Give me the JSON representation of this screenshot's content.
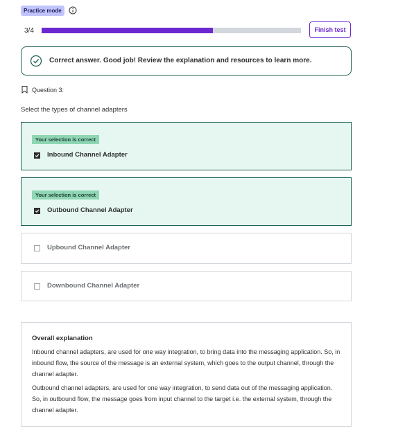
{
  "header": {
    "mode_badge": "Practice mode",
    "progress_text": "3/4",
    "progress_fraction": 0.66,
    "finish_label": "Finish test"
  },
  "result": {
    "message": "Correct answer. Good job! Review the explanation and resources to learn more."
  },
  "question": {
    "label": "Question 3:",
    "text": "Select the types of channel adapters"
  },
  "options": [
    {
      "tag": "Your selection is correct",
      "label": "Inbound Channel Adapter",
      "checked": true
    },
    {
      "tag": "Your selection is correct",
      "label": "Outbound Channel Adapter",
      "checked": true
    },
    {
      "label": "Upbound Channel Adapter",
      "checked": false
    },
    {
      "label": "Downbound Channel Adapter",
      "checked": false
    }
  ],
  "explanation": {
    "title": "Overall explanation",
    "paragraphs": [
      "Inbound channel adapters, are used for one way integration, to bring data into the messaging application. So, in inbound flow, the source of the message is an external system, which goes to the output channel, through the channel adapter.",
      "Outbound channel adapters, are used for one way integration, to send data out of the messaging application. So, in outbound flow, the message goes from input channel to the target i.e. the external system, through the channel adapter."
    ]
  },
  "colors": {
    "accent": "#6d28d2",
    "correct_border": "#1e6055",
    "correct_bg": "#e6f7f1",
    "correct_tag": "#8ed6b4"
  }
}
